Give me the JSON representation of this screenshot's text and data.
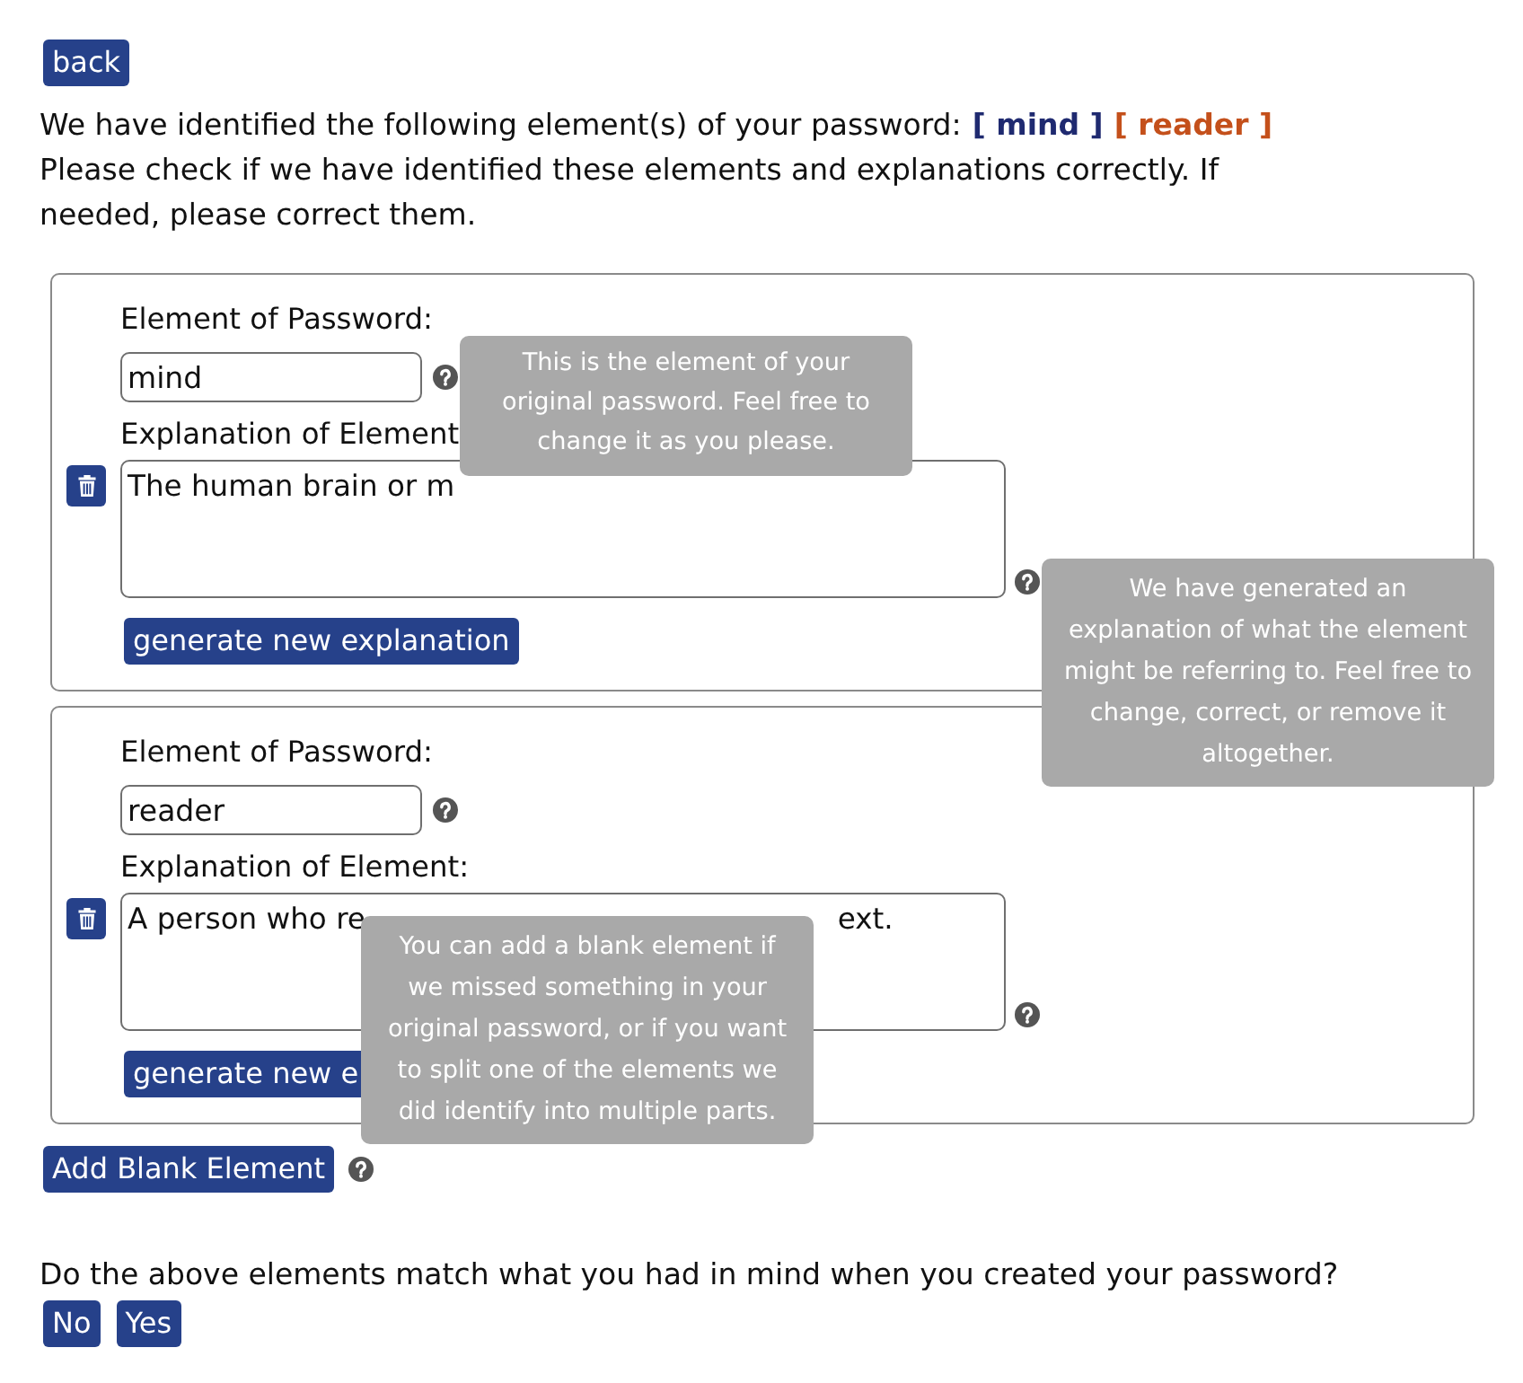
{
  "back_button": "back",
  "intro": {
    "text": "We have identified the following element(s) of your password:",
    "tags": [
      {
        "text": "[ mind ]",
        "color": "#1f2a70"
      },
      {
        "text": "[ reader ]",
        "color": "#c4501b"
      }
    ]
  },
  "instructions": "Please check if we have identified these elements and explanations correctly. If needed, please correct them.",
  "elements": [
    {
      "element_label": "Element of Password:",
      "element_value": "mind",
      "element_tooltip": "This is the element of your original password. Feel free to change it as you please.",
      "explanation_label": "Explanation of Element",
      "explanation_parts": [
        "The human brain or m"
      ],
      "explanation_tooltip": "We have generated an explanation of what the element might be referring to. Feel free to change, correct, or remove it altogether.",
      "generate_button": "generate new explanation"
    },
    {
      "element_label": "Element of Password:",
      "element_value": "reader",
      "explanation_label": "Explanation of Element:",
      "explanation_parts": [
        "A person who re",
        "ext."
      ],
      "generate_button": "generate new e"
    }
  ],
  "add_blank": {
    "label": "Add Blank Element",
    "tooltip": "You can add a blank element if we missed something in your original password, or if you want to split one of the elements we did identify into multiple parts."
  },
  "question": "Do the above elements match what you had in mind when you created your password?",
  "answer_buttons": [
    "No",
    "Yes"
  ]
}
